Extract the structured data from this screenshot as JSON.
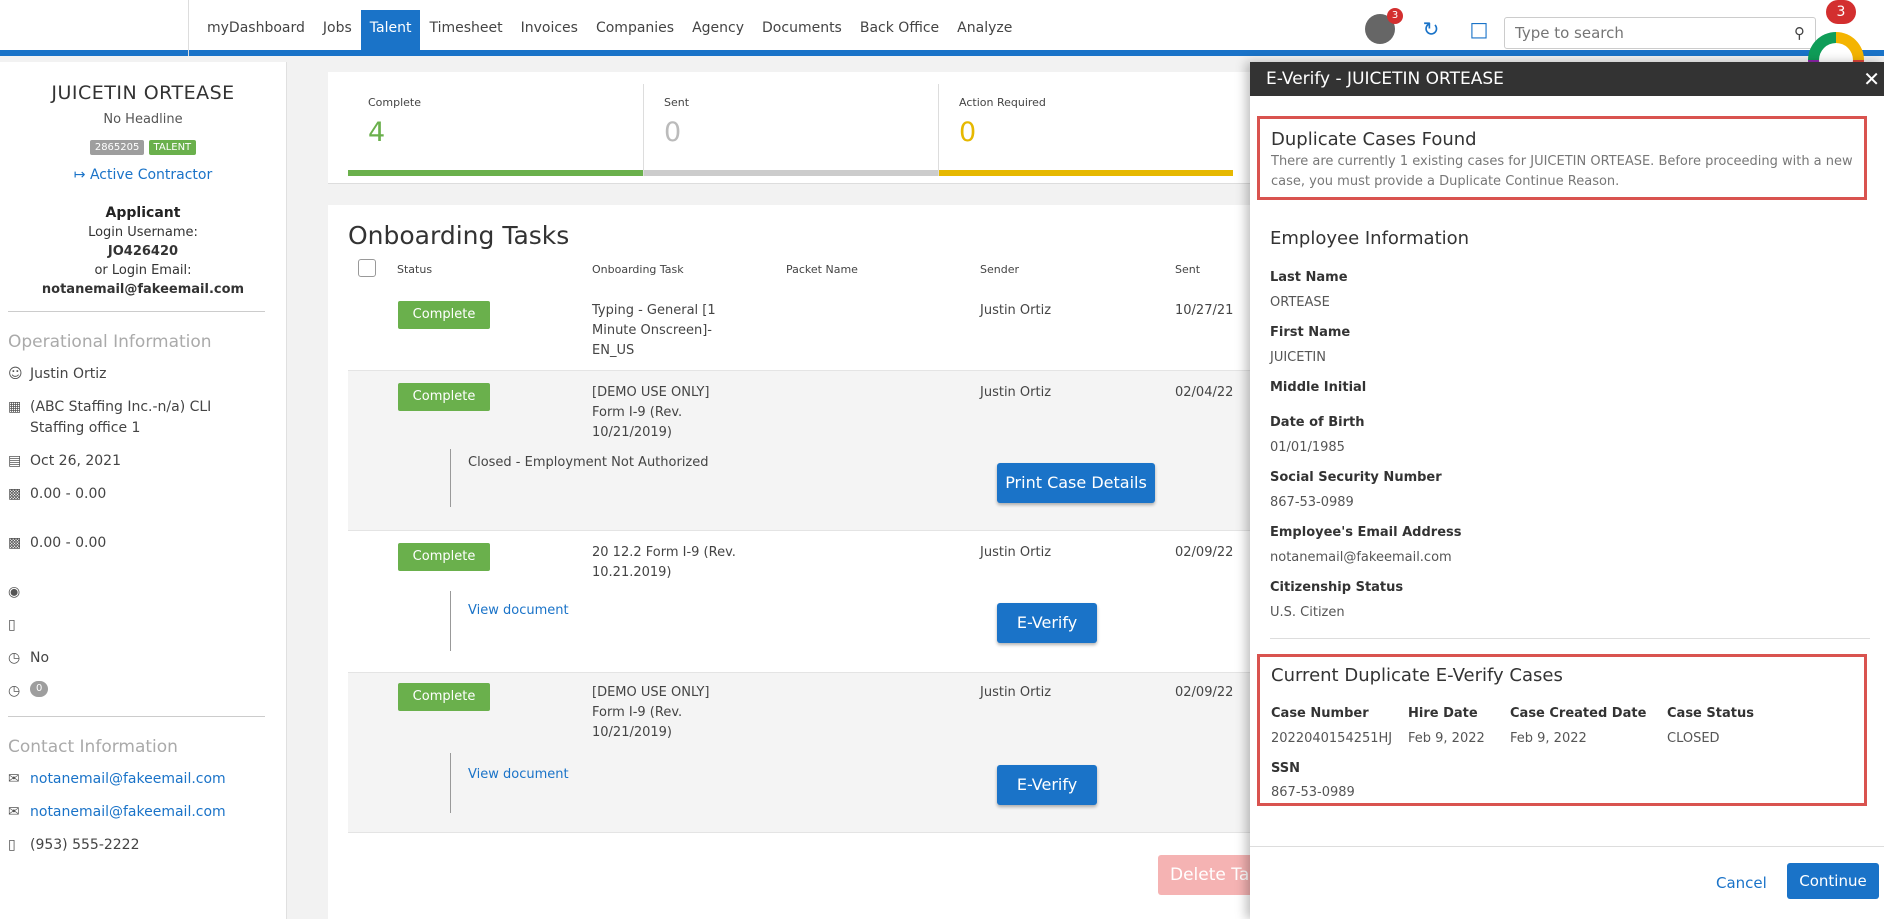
{
  "nav": {
    "links": [
      "myDashboard",
      "Jobs",
      "Talent",
      "Timesheet",
      "Invoices",
      "Companies",
      "Agency",
      "Documents",
      "Back Office",
      "Analyze"
    ],
    "notification_count": "3",
    "search_placeholder": "Type to search",
    "logo_badge": "3"
  },
  "sidebar": {
    "name": "JUICETIN ORTEASE",
    "headline": "No Headline",
    "id_tag": "2865205",
    "type_tag": "TALENT",
    "status_link": "Active Contractor",
    "role": "Applicant",
    "login_username_label": "Login Username:",
    "login_username": "JO426420",
    "login_email_label": "or Login Email:",
    "login_email": "notanemail@fakeemail.com",
    "operational_title": "Operational Information",
    "recruiter": "Justin Ortiz",
    "office": "(ABC Staffing Inc.-n/a) CLI Staffing office 1",
    "date": "Oct 26, 2021",
    "pay1": "0.00 - 0.00",
    "pay2": "0.00 - 0.00",
    "availability": "No",
    "zero_count": "0",
    "contact_title": "Contact Information",
    "email1": "notanemail@fakeemail.com",
    "email2": "notanemail@fakeemail.com",
    "phone": "(953) 555-2222"
  },
  "stats": [
    {
      "label": "Complete",
      "value": "4",
      "color": "#6ab04c"
    },
    {
      "label": "Sent",
      "value": "0",
      "color": "#cccccc"
    },
    {
      "label": "Action Required",
      "value": "0",
      "color": "#e6b800"
    }
  ],
  "tasks": {
    "title": "Onboarding Tasks",
    "headers": {
      "status": "Status",
      "task": "Onboarding Task",
      "packet": "Packet Name",
      "sender": "Sender",
      "sent": "Sent"
    },
    "rows": [
      {
        "status": "Complete",
        "task": "Typing - General [1 Minute Onscreen]- EN_US",
        "sender": "Justin Ortiz",
        "sent": "10/27/21"
      },
      {
        "status": "Complete",
        "task": "[DEMO USE ONLY] Form I-9 (Rev. 10/21/2019)",
        "sender": "Justin Ortiz",
        "sent": "02/04/22",
        "sub_text": "Closed - Employment Not Authorized",
        "sub_button": "Print Case Details"
      },
      {
        "status": "Complete",
        "task": "20 12.2 Form I-9 (Rev. 10.21.2019)",
        "sender": "Justin Ortiz",
        "sent": "02/09/22",
        "sub_link": "View document",
        "sub_button": "E-Verify"
      },
      {
        "status": "Complete",
        "task": "[DEMO USE ONLY] Form I-9 (Rev. 10/21/2019)",
        "sender": "Justin Ortiz",
        "sent": "02/09/22",
        "sub_link": "View document",
        "sub_button": "E-Verify"
      }
    ],
    "delete_label": "Delete Ta"
  },
  "panel": {
    "title": "E-Verify - JUICETIN ORTEASE",
    "dup_title": "Duplicate Cases Found",
    "dup_text": "There are currently 1 existing cases for JUICETIN ORTEASE. Before proceeding with a new case, you must provide a Duplicate Continue Reason.",
    "employee_title": "Employee Information",
    "fields": [
      {
        "label": "Last Name",
        "value": "ORTEASE"
      },
      {
        "label": "First Name",
        "value": "JUICETIN"
      },
      {
        "label": "Middle Initial",
        "value": ""
      },
      {
        "label": "Date of Birth",
        "value": "01/01/1985"
      },
      {
        "label": "Social Security Number",
        "value": "867-53-0989"
      },
      {
        "label": "Employee's Email Address",
        "value": "notanemail@fakeemail.com"
      },
      {
        "label": "Citizenship Status",
        "value": "U.S. Citizen"
      }
    ],
    "cases_title": "Current Duplicate E-Verify Cases",
    "case_headers": {
      "number": "Case Number",
      "hire": "Hire Date",
      "created": "Case Created Date",
      "status": "Case Status",
      "ssn": "SSN"
    },
    "case": {
      "number": "2022040154251HJ",
      "hire": "Feb 9, 2022",
      "created": "Feb 9, 2022",
      "status": "CLOSED",
      "ssn": "867-53-0989"
    },
    "cancel": "Cancel",
    "continue": "Continue"
  }
}
